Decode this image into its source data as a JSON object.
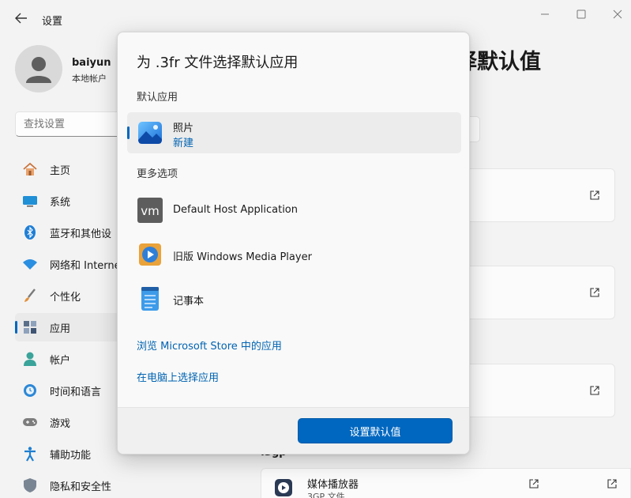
{
  "window": {
    "title": "设置",
    "icons": {
      "back": "back-arrow-icon",
      "minimize": "minimize-icon",
      "maximize": "maximize-icon",
      "close": "close-icon"
    }
  },
  "user": {
    "name": "baiyun",
    "account_type": "本地帐户"
  },
  "search": {
    "placeholder": "查找设置"
  },
  "sidebar": {
    "items": [
      {
        "label": "主页",
        "icon": "home-icon"
      },
      {
        "label": "系统",
        "icon": "system-icon"
      },
      {
        "label": "蓝牙和其他设",
        "icon": "bluetooth-icon"
      },
      {
        "label": "网络和 Interne",
        "icon": "wifi-icon"
      },
      {
        "label": "个性化",
        "icon": "brush-icon"
      },
      {
        "label": "应用",
        "icon": "apps-icon",
        "active": true
      },
      {
        "label": "帐户",
        "icon": "account-icon"
      },
      {
        "label": "时间和语言",
        "icon": "globe-clock-icon"
      },
      {
        "label": "游戏",
        "icon": "gamepad-icon"
      },
      {
        "label": "辅助功能",
        "icon": "accessibility-icon"
      },
      {
        "label": "隐私和安全性",
        "icon": "shield-icon"
      }
    ]
  },
  "main": {
    "heading_partial": "择默认值",
    "section_partial": ".3gp",
    "media_row": {
      "name": "媒体播放器",
      "sub": "3GP 文件"
    }
  },
  "dialog": {
    "title": "为 .3fr 文件选择默认应用",
    "default_section": "默认应用",
    "default_app": {
      "name": "照片",
      "sub": "新建",
      "icon": "photos-icon"
    },
    "more_section": "更多选项",
    "options": [
      {
        "name": "Default Host Application",
        "icon": "vmware-icon"
      },
      {
        "name": "旧版 Windows Media Player",
        "icon": "media-player-icon"
      },
      {
        "name": "记事本",
        "icon": "notepad-icon"
      }
    ],
    "link_store": "浏览 Microsoft Store 中的应用",
    "link_pc": "在电脑上选择应用",
    "button": "设置默认值"
  },
  "colors": {
    "accent": "#0067c0",
    "link": "#0063b1"
  }
}
